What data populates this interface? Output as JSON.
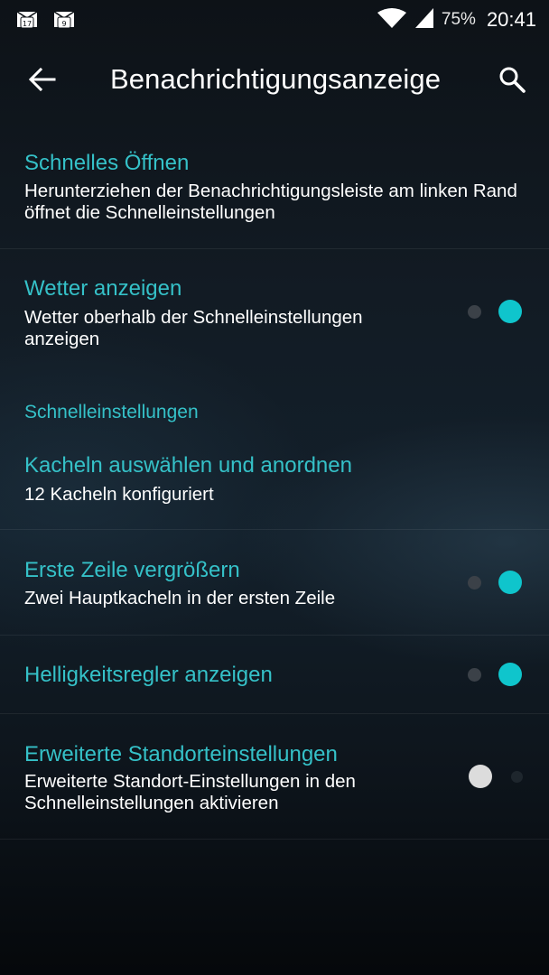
{
  "status_bar": {
    "notifications": [
      {
        "icon": "mail-calendar-icon",
        "badge": "17"
      },
      {
        "icon": "mail-calendar-icon",
        "badge": "9"
      }
    ],
    "wifi_icon": "wifi-icon",
    "signal_icon": "cell-signal-icon",
    "battery": "75%",
    "time": "20:41"
  },
  "toolbar": {
    "back_icon": "arrow-left-icon",
    "title": "Benachrichtigungsanzeige",
    "search_icon": "search-icon"
  },
  "settings": {
    "quick_pulldown": {
      "title": "Schnelles Öffnen",
      "summary": "Herunterziehen der Benachrichtigungsleiste am linken Rand öffnet die Schnelleinstellungen"
    },
    "show_weather": {
      "title": "Wetter anzeigen",
      "summary": "Wetter oberhalb der Schnelleinstellungen anzeigen",
      "enabled": true
    },
    "category_quick_settings": "Schnelleinstellungen",
    "tiles": {
      "title": "Kacheln auswählen und anordnen",
      "summary": "12 Kacheln konfiguriert"
    },
    "enlarge_first_row": {
      "title": "Erste Zeile vergrößern",
      "summary": "Zwei Hauptkacheln in der ersten Zeile",
      "enabled": true
    },
    "brightness_slider": {
      "title": "Helligkeitsregler anzeigen",
      "enabled": true
    },
    "advanced_location": {
      "title": "Erweiterte Standorteinstellungen",
      "summary": "Erweiterte Standort-Einstellungen in den Schnelleinstellungen aktivieren",
      "enabled": false
    }
  },
  "colors": {
    "accent": "#35c1c8",
    "switch_on": "#0fc5cc",
    "switch_off_thumb": "#dcdcdc",
    "background": "#121b24"
  }
}
